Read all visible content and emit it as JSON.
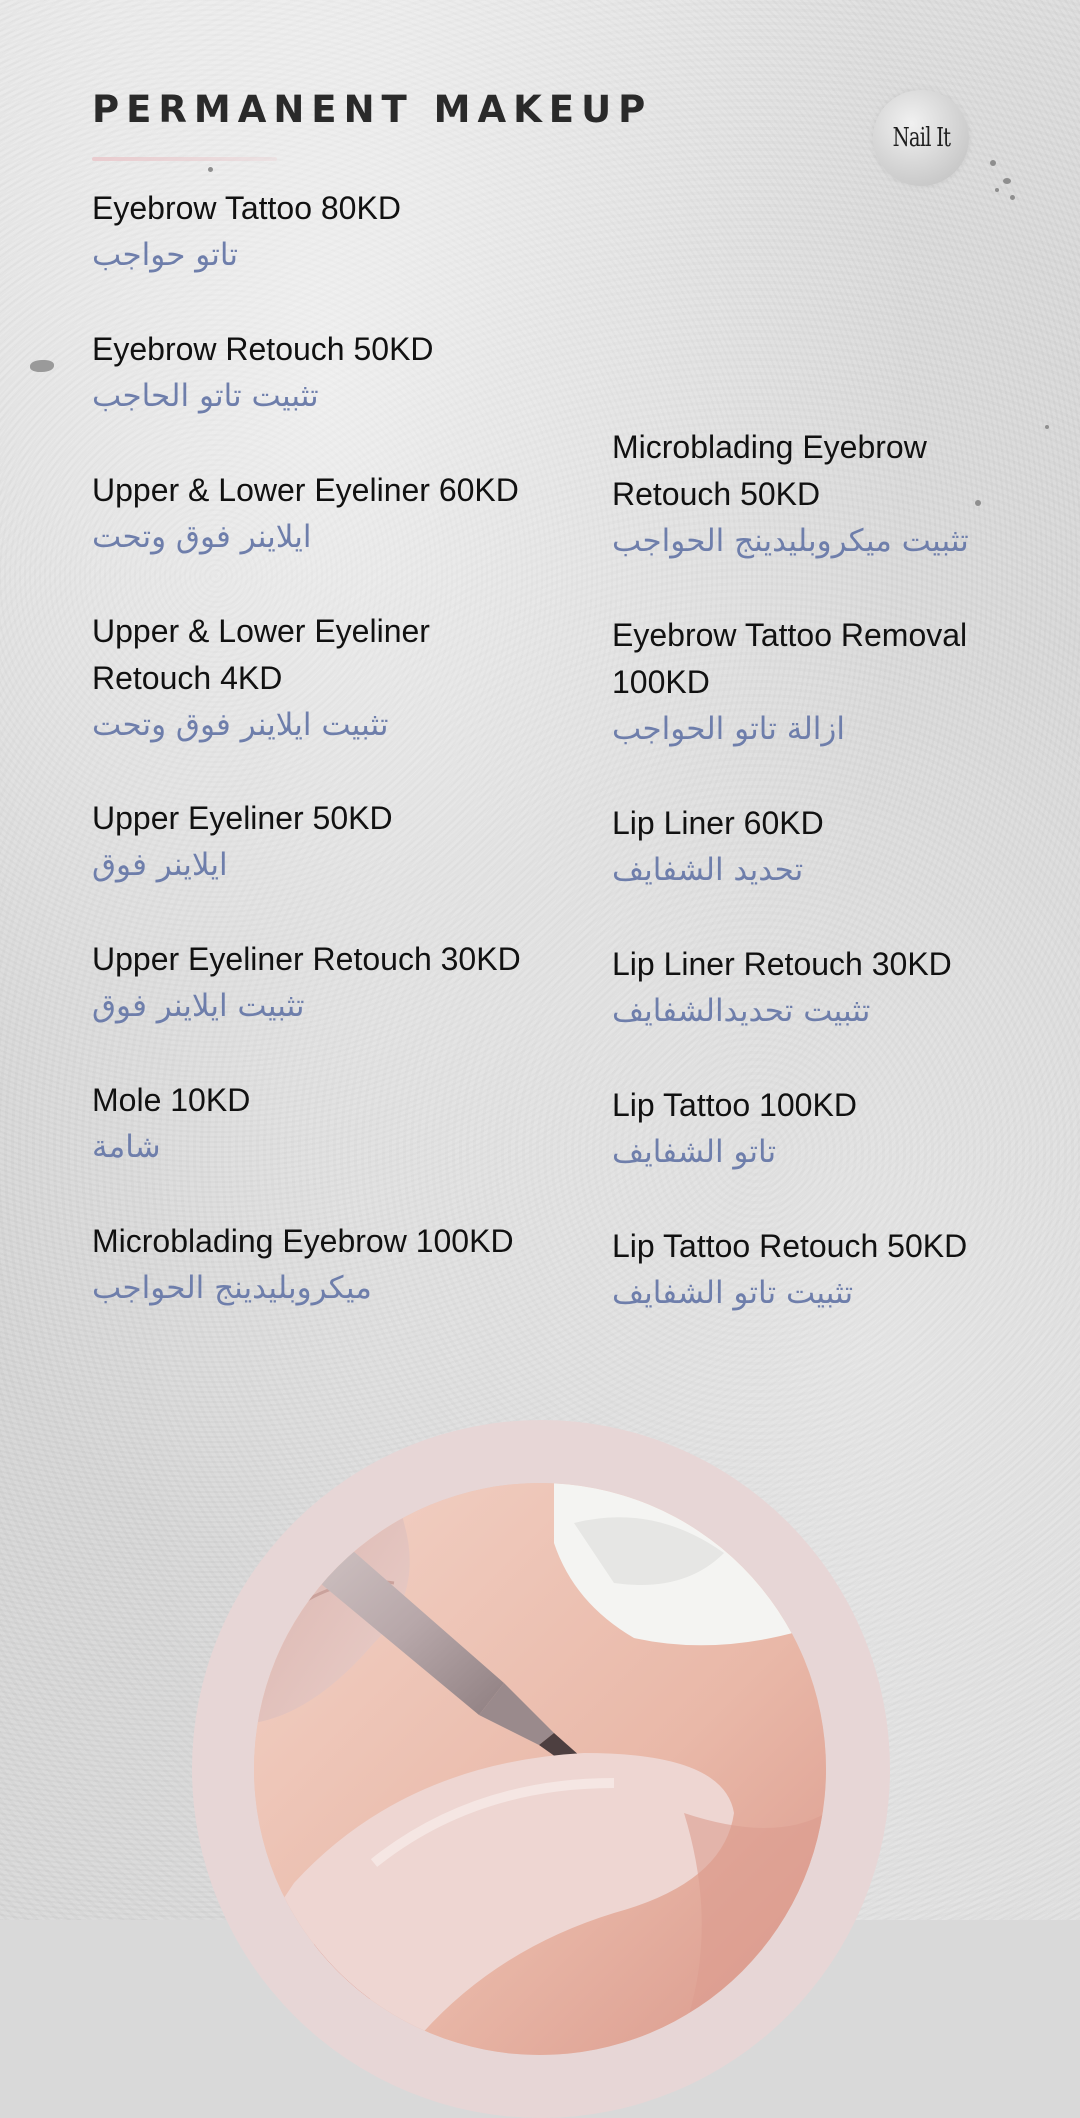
{
  "page": {
    "title": "PERMANENT MAKEUP",
    "logo_text": "Nail It"
  },
  "colors": {
    "english_text": "#111111",
    "arabic_text": "#6e7eab",
    "title": "#2a2a2a",
    "ring": "#e7d6d6"
  },
  "left_items": [
    {
      "en": "Eyebrow Tattoo 80KD",
      "ar": "تاتو حواجب"
    },
    {
      "en": "Eyebrow Retouch 50KD",
      "ar": "تثبيت تاتو الحاجب"
    },
    {
      "en": "Upper & Lower Eyeliner 60KD",
      "ar": "ايلاينر فوق وتحت"
    },
    {
      "en": "Upper & Lower Eyeliner Retouch 4KD",
      "ar": "تثبيت ايلاينر فوق وتحت"
    },
    {
      "en": "Upper Eyeliner 50KD",
      "ar": "ايلاينر فوق"
    },
    {
      "en": "Upper Eyeliner Retouch 30KD",
      "ar": "تثبيت ايلاينر فوق"
    },
    {
      "en": "Mole 10KD",
      "ar": "شامة"
    },
    {
      "en": "Microblading Eyebrow 100KD",
      "ar": "ميكروبليدينج الحواجب"
    }
  ],
  "right_items": [
    {
      "en": "Microblading Eyebrow Retouch  50KD",
      "ar": "تثبيت ميكروبليدينج الحواجب"
    },
    {
      "en": "Eyebrow Tattoo Removal 100KD",
      "ar": "ازالة تاتو الحواجب"
    },
    {
      "en": "Lip Liner 60KD",
      "ar": "تحديد الشفايف"
    },
    {
      "en": "Lip Liner Retouch 30KD",
      "ar": "تثبيت تحديدالشفايف"
    },
    {
      "en": "Lip Tattoo 100KD",
      "ar": "تاتو الشفايف"
    },
    {
      "en": "Lip Tattoo Retouch 50KD",
      "ar": "تثبيت تاتو الشفايف"
    }
  ],
  "photo": {
    "subject": "permanent makeup tattoo pen applied to lip"
  }
}
